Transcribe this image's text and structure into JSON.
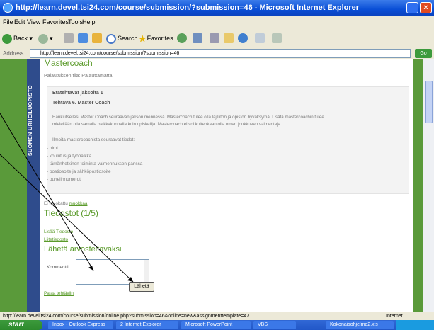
{
  "window": {
    "title": "http://learn.devel.tsi24.com/course/submission/?submission=46 - Microsoft Internet Explorer"
  },
  "menu": [
    "File",
    "Edit",
    "View",
    "Favorites",
    "Tools",
    "Help"
  ],
  "toolbar": {
    "back_label": "Back",
    "search_label": "Search",
    "favorites_label": "Favorites"
  },
  "address": {
    "label": "Address",
    "url": "http://learn.devel.tsi24.com/course/submission/?submission=46",
    "go_label": "Go"
  },
  "sidebar": {
    "text": "SUOMEN URHEILUOPISTO"
  },
  "page": {
    "heading": "Mastercoach",
    "status": "Palautuksen tila: Palauttamatta.",
    "section_title": "Etätehtävät jaksolta 1",
    "task_title": "Tehtävä 6. Master Coach",
    "description_line1": "Hanki itsellesi Master Coach seuraavan jakson mennessä. Mastercoach tulee olla lajiliiton ja opiston hyväksymä. Lisätä mastercoachin tulee",
    "description_line2": "mielellään olla samalla paikkakunnalla kuin opiskelija. Mastercoach ei voi kuitenkaan olla oman joukkueen valmentaja.",
    "list_intro": "Ilmoita mastercoachista seuraavat tiedot:",
    "list_items": [
      "- nimi",
      "- koulutus ja työpaikka",
      "- tämänhetkinen toiminta valmennuksen parissa",
      "- postiosoite ja sähköpostiosoite",
      "- puhelinnumerot"
    ],
    "modified_prefix": "Ei muokattu",
    "modified_link": "muokkaa",
    "files_heading": "Tiedostot (1/5)",
    "add_file_link": "Lisää Tiedosto",
    "attached_file_link": "Liitetiedosto",
    "send_heading": "Lähetä arvosteltavaksi",
    "comment_label": "Kommentti",
    "submit_label": "Lähetä",
    "back_link": "Palaa tehtäviin"
  },
  "status_bar": {
    "url": "http://learn.devel.tsi24.com/course/submission/online.php?submission=46&online=new&assignmenttemplate=47",
    "zone": "Internet"
  },
  "taskbar": {
    "start_label": "start",
    "tasks": [
      "Inbox - Outlook Express",
      "2 Internet Explorer",
      "Microsoft PowerPoint",
      "VBS",
      "Kokonaisohjelma2.xls"
    ]
  },
  "colors": {
    "title_bar": "#0a4fd6",
    "page_background": "#5a9a3a",
    "heading_green": "#5a9a2a",
    "sidebar_blue": "#2f4c8c"
  }
}
